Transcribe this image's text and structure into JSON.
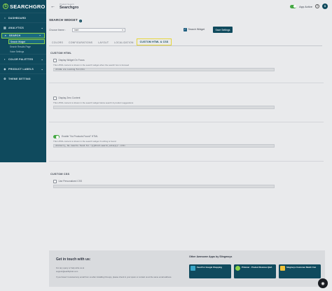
{
  "app": {
    "logo_mark": "S",
    "logo_text": "SEARCHGRO"
  },
  "sidebar": {
    "items": [
      {
        "label": "DASHBOARD",
        "icon": "home-icon"
      },
      {
        "label": "ANALYTICS",
        "icon": "bar-chart-icon"
      },
      {
        "label": "SEARCH",
        "icon": "search-icon"
      },
      {
        "label": "COLOR PALETTES",
        "icon": "palette-icon"
      },
      {
        "label": "PRODUCT LABELS",
        "icon": "tag-icon"
      },
      {
        "label": "THEME SETTING",
        "icon": "gear-icon"
      }
    ],
    "search_sub": [
      {
        "label": "Search Widget"
      },
      {
        "label": "Search Results Page"
      },
      {
        "label": "Voice Settings"
      }
    ]
  },
  "topbar": {
    "back_glyph": "←",
    "crumb_small": "Product Search",
    "title": "Searchgro",
    "app_active_label": "App Active",
    "help_glyph": "?",
    "avatar_text": "S"
  },
  "widget": {
    "header": "SEARCH WIDGET",
    "info_glyph": "i",
    "theme_label": "Choose theme :",
    "theme_value": "Inert",
    "search_widget_label": "Search Widget",
    "save_label": "Save Settings"
  },
  "tabs": [
    {
      "label": "COLORS"
    },
    {
      "label": "CONFIGURATIONS"
    },
    {
      "label": "LAYOUT"
    },
    {
      "label": "LOCALIZATION"
    },
    {
      "label": "CUSTOM HTML & CSS"
    }
  ],
  "custom_html": {
    "title": "CUSTOM HTML",
    "opt1": {
      "label": "Display Widget On Focus",
      "help": "This HTML content is shown in the search widget when the search box is focused",
      "code": "<h1>We are Looking For</h1>"
    },
    "opt2": {
      "label": "Display Zero Content",
      "help": "This HTML content is shown in the search widget below search & product suggestions"
    },
    "opt3": {
      "label": "Enable \"No Products Found\" HTML",
      "help": "This HTML content is shown in the search widget if nothing is found",
      "code": "<h1>Sorry, No results found for \"{{{#root.search_value}}}\" </h1>"
    }
  },
  "custom_css": {
    "title": "CUSTOM CSS",
    "opt1": {
      "label": "Use Personalized CSS"
    }
  },
  "footer": {
    "title": "Get in touch with us:",
    "line1": "For any query or help write us at",
    "line2": "support@earthlyhub.com",
    "line3": "If you haven't received any email from us after installing this app, please check in your spam or contact us at the same email address.",
    "other_apps_title": "Other Awesome Apps by Slingmoys",
    "apps": [
      {
        "label": "Feed For Google Shopping"
      },
      {
        "label": "Primmer - Product Reviews Q&A"
      },
      {
        "label": "Singmoys Customer Match Con"
      }
    ]
  },
  "chat_glyph": "◉"
}
